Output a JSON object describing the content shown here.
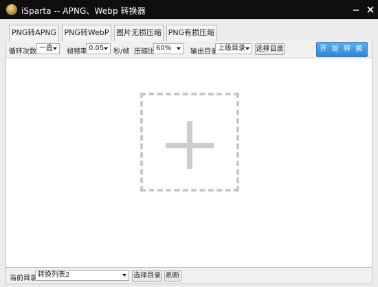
{
  "window": {
    "title": "iSparta -- APNG、Webp 转换器",
    "minimize_icon": "minimize-icon",
    "close_icon": "close-icon"
  },
  "tabs": [
    {
      "label": "PNG转APNG",
      "active": true
    },
    {
      "label": "PNG转WebP",
      "active": false
    },
    {
      "label": "图片无损压缩",
      "active": false
    },
    {
      "label": "PNG有损压缩",
      "active": false
    }
  ],
  "toolbar": {
    "loop_label": "循环次数",
    "loop_value": "一直",
    "fps_label": "帧频率",
    "fps_value": "0.05",
    "fps_unit": "秒/帧",
    "ratio_label": "压缩比",
    "ratio_value": "60%",
    "output_label": "输出目录",
    "output_value": "上级目录",
    "choose_dir_label": "选择目录",
    "start_label": "开 始 转 换"
  },
  "drop_zone": {
    "icon": "plus-icon"
  },
  "bottom": {
    "current_dir_label": "当前目录",
    "current_dir_value": "转换列表2",
    "choose_dir_label": "选择目录",
    "refresh_label": "刷新"
  },
  "colors": {
    "titlebar": "#0f0f0f",
    "accent": "#3a93e0",
    "drop_dash": "#c8c8c8"
  }
}
